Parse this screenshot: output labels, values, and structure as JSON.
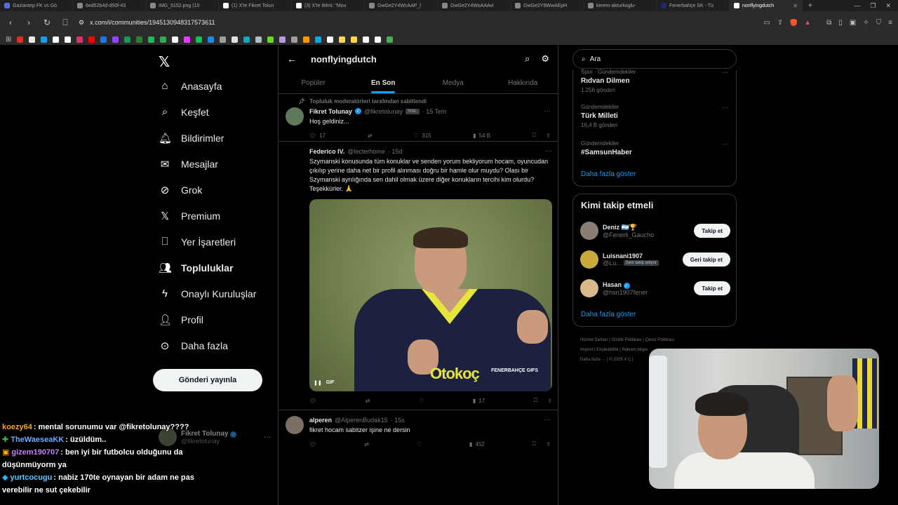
{
  "browser": {
    "tabs": [
      {
        "label": "Gaziantep FK vs Gö",
        "color": "#5b6bd8"
      },
      {
        "label": "6ed52b4d-d50f-43",
        "color": "#888888"
      },
      {
        "label": "IMG_5152.png (10",
        "color": "#888888"
      },
      {
        "label": "(1) X'te Fikret Tolun",
        "color": "#ffffff"
      },
      {
        "label": "(3) X'te IMmi: \"Mou",
        "color": "#ffffff"
      },
      {
        "label": "GwGe2Y4WcAAP_l",
        "color": "#888888"
      },
      {
        "label": "GwGe2Y4WoAAAvi",
        "color": "#888888"
      },
      {
        "label": "GwGe2Y9WwAEpH",
        "color": "#888888"
      },
      {
        "label": "kerem-akturkoglu-",
        "color": "#888888"
      },
      {
        "label": "Fenerbahçe SK - Tü",
        "color": "#1d2a6b"
      },
      {
        "label": "nonflyingdutch",
        "color": "#ffffff",
        "active": true
      }
    ],
    "url": "x.com/i/communities/1945130948317573611",
    "bookmark_colors": [
      "#d93025",
      "#e8e8e8",
      "#1d9bf0",
      "#ffffff",
      "#ffffff",
      "#e1306c",
      "#ff0000",
      "#1877f2",
      "#9146ff",
      "#0f9d58",
      "#2e7d32",
      "#1db954",
      "#34a853",
      "#ffffff",
      "#e040fb",
      "#00c853",
      "#1e88e5",
      "#9e9e9e",
      "#e0e0e0",
      "#00acc1",
      "#b0bec5",
      "#64dd17",
      "#b39ddb",
      "#9e9e9e",
      "#ff9800",
      "#03a9f4",
      "#ffffff",
      "#ffd54f",
      "#ffd54f",
      "#ffffff",
      "#ffffff",
      "#4caf50"
    ]
  },
  "nav": {
    "items": [
      {
        "label": "Anasayfa",
        "icon": "home-icon",
        "glyph": "⌂"
      },
      {
        "label": "Keşfet",
        "icon": "search-icon",
        "glyph": "⌕"
      },
      {
        "label": "Bildirimler",
        "icon": "bell-icon",
        "glyph": "🔔︎"
      },
      {
        "label": "Mesajlar",
        "icon": "mail-icon",
        "glyph": "✉"
      },
      {
        "label": "Grok",
        "icon": "grok-icon",
        "glyph": "⊘"
      },
      {
        "label": "Premium",
        "icon": "x-premium-icon",
        "glyph": "𝕏"
      },
      {
        "label": "Yer İşaretleri",
        "icon": "bookmark-icon",
        "glyph": "⎕"
      },
      {
        "label": "Topluluklar",
        "icon": "communities-icon",
        "glyph": "👥︎"
      },
      {
        "label": "Onaylı Kuruluşlar",
        "icon": "lightning-icon",
        "glyph": "ϟ"
      },
      {
        "label": "Profil",
        "icon": "profile-icon",
        "glyph": "👤︎"
      },
      {
        "label": "Daha fazla",
        "icon": "more-circle-icon",
        "glyph": "⊙"
      }
    ],
    "post_button": "Gönderi yayınla",
    "profile": {
      "name": "Fikret Tolunay",
      "handle": "@fikretolunay"
    }
  },
  "main": {
    "title": "nonflyingdutch",
    "tabs": [
      "Popüler",
      "En Son",
      "Medya",
      "Hakkında"
    ],
    "pinned_label": "Topluluk moderatörleri tarafından sabitlendi",
    "posts": [
      {
        "name": "Fikret Tolunay",
        "handle": "@fikretolunay",
        "badge": "Yntc.",
        "time": "· 15 Tem",
        "text": "Hoş geldiniz...",
        "replies": "17",
        "retweets": "",
        "likes": "315",
        "views": "54 B"
      },
      {
        "name": "Federico IV.",
        "handle": "@lecterhome",
        "time": "· 15d",
        "text": "Szymanski konusunda tüm konuklar ve senden yorum bekliyorum hocam, oyuncudan çıkılıp yerine daha net bir profil alınması doğru bir hamle olur muydu? Olası bir Szymanski ayrılığında sen dahil olmak üzere diğer konukların tercihi kim olurdu? Teşekkürler. 🙏",
        "gif_label": "GIF",
        "sponsor": "Otokoç",
        "watermark": "FENERBAHÇE GIFS",
        "views": "17"
      },
      {
        "name": "alperen",
        "handle": "@AlperenBudak15",
        "time": "· 15s",
        "text": "fikret hocam sabitzer işine ne dersin",
        "views": "452"
      }
    ]
  },
  "right": {
    "search_placeholder": "Ara",
    "trends": [
      {
        "category": "Spor · Gündemdekiler",
        "name": "Rıdvan Dilmen",
        "count": "1.256 gönderi"
      },
      {
        "category": "Gündemdekiler",
        "name": "Türk Milleti",
        "count": "16,4 B gönderi"
      },
      {
        "category": "Gündemdekiler",
        "name": "#SamsunHaber",
        "count": ""
      }
    ],
    "show_more": "Daha fazla göster",
    "follow_title": "Kimi takip etmeli",
    "follow": [
      {
        "name": "Deniz 🇦🇷🏆",
        "handle": "@Fenerli_Gaucho",
        "button": "Takip et",
        "tag": "",
        "color": "#8a7f74"
      },
      {
        "name": "Luisnani1907",
        "handle": "@Lu...",
        "button": "Geri takip et",
        "tag": "Seni takip ediyor",
        "color": "#caa93c"
      },
      {
        "name": "Hasan",
        "handle": "@hsn1907fener",
        "button": "Takip et",
        "tag": "",
        "color": "#d9b98a",
        "verified": true
      }
    ],
    "footer_links": [
      "Hizmet Şartları",
      "Gizlilik Politikası",
      "Çerez Politikası",
      "Imprint",
      "Erişilebilirlik",
      "Reklam bilgisi",
      "Daha fazla ···",
      "© 2025 X C"
    ]
  },
  "chat": [
    {
      "user": "koezy64",
      "color": "#f5a623",
      "badge": "",
      "text": ": mental sorunumu var @fikretolunay????"
    },
    {
      "user": "TheWaeseaKK",
      "color": "#6fa8ff",
      "badge": "✚",
      "badge_color": "#4caf50",
      "text": ": üzüldüm.."
    },
    {
      "user": "gizem190707",
      "color": "#c77dff",
      "badge": "▣",
      "badge_color": "#ffb300",
      "text": ": ben iyi bir futbolcu olduğunu da"
    },
    {
      "user": "",
      "color": "#fff",
      "badge": "",
      "text": "düşünmüyorm ya"
    },
    {
      "user": "yurtcocugu",
      "color": "#5ec8ff",
      "badge": "◆",
      "badge_color": "#29b6f6",
      "text": ": nabiz 170te oynayan bir adam ne pas"
    },
    {
      "user": "",
      "color": "#fff",
      "badge": "",
      "text": "verebilir ne sut çekebilir"
    }
  ]
}
